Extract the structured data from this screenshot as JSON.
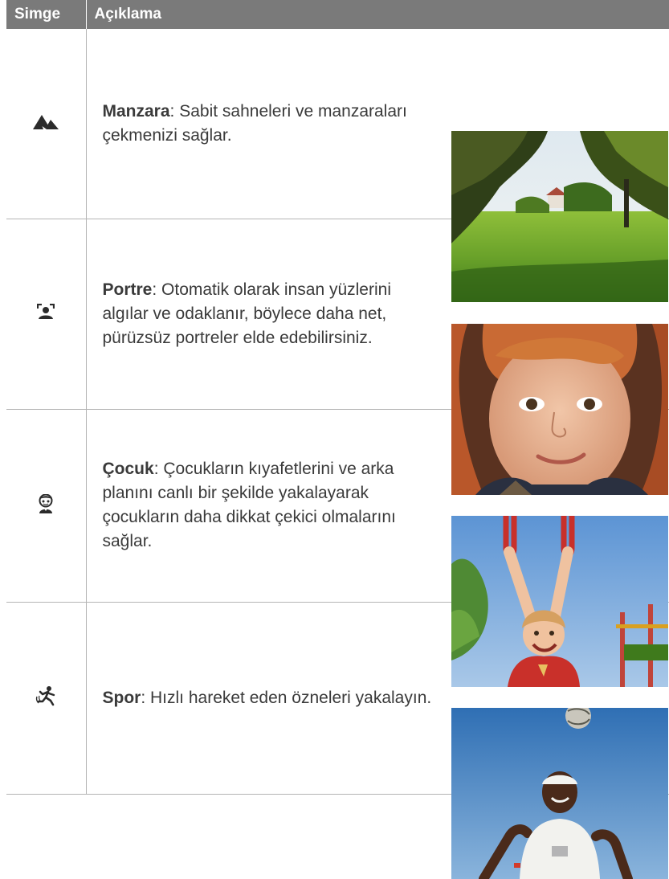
{
  "header": {
    "col_icon": "Simge",
    "col_desc": "Açıklama"
  },
  "rows": [
    {
      "icon": "landscape-icon",
      "term": "Manzara",
      "description": ": Sabit sahneleri ve manzaraları çekmenizi sağlar.",
      "photo": "landscape-photo"
    },
    {
      "icon": "portrait-icon",
      "term": "Portre",
      "description": ": Otomatik olarak insan yüzlerini algılar ve odaklanır, böylece daha net, pürüzsüz portreler elde edebilirsiniz.",
      "photo": "portrait-photo"
    },
    {
      "icon": "children-icon",
      "term": "Çocuk",
      "description": ": Çocukların kıyafetlerini ve arka planını canlı bir şekilde yakalayarak çocukların daha dikkat çekici olmalarını sağlar.",
      "photo": "children-photo"
    },
    {
      "icon": "sports-icon",
      "term": "Spor",
      "description": ": Hızlı hareket eden özneleri yakalayın.",
      "photo": "sports-photo"
    }
  ],
  "colors": {
    "header_bg": "#7a7a7a",
    "header_text": "#ffffff",
    "border": "#b4b4b4",
    "body_text": "#3a3a3a",
    "icon": "#2b2b2b"
  }
}
